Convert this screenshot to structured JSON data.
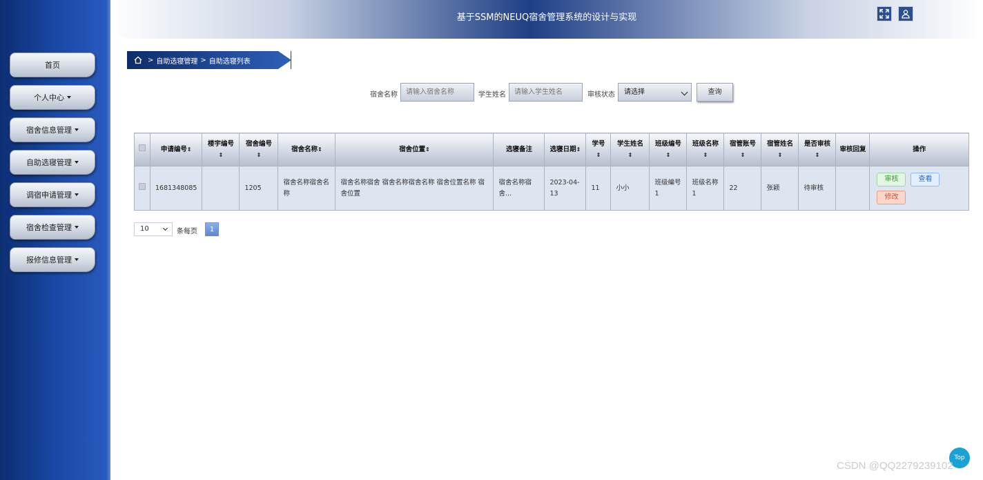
{
  "header": {
    "title": "基于SSM的NEUQ宿舍管理系统的设计与实现",
    "icons": [
      "fullscreen-icon",
      "user-icon"
    ]
  },
  "sidebar": {
    "items": [
      {
        "label": "首页",
        "has_dropdown": false
      },
      {
        "label": "个人中心",
        "has_dropdown": true
      },
      {
        "label": "宿舍信息管理",
        "has_dropdown": true
      },
      {
        "label": "自助选寝管理",
        "has_dropdown": true
      },
      {
        "label": "调宿申请管理",
        "has_dropdown": true
      },
      {
        "label": "宿舍检查管理",
        "has_dropdown": true
      },
      {
        "label": "报修信息管理",
        "has_dropdown": true
      }
    ]
  },
  "breadcrumb": {
    "sep": ">",
    "items": [
      "自助选寝管理",
      "自助选寝列表"
    ]
  },
  "search": {
    "dorm_name_label": "宿舍名称",
    "dorm_name_placeholder": "请输入宿舍名称",
    "student_name_label": "学生姓名",
    "student_name_placeholder": "请输入学生姓名",
    "audit_label": "审核状态",
    "audit_selected": "请选择",
    "query_label": "查询"
  },
  "table": {
    "columns": [
      "申请编号",
      "楼宇编号",
      "宿舍编号",
      "宿舍名称",
      "宿舍位置",
      "选寝备注",
      "选寝日期",
      "学号",
      "学生姓名",
      "班级编号",
      "班级名称",
      "宿管账号",
      "宿管姓名",
      "是否审核",
      "审核回复",
      "操作"
    ],
    "rows": [
      {
        "cells": [
          "1681348085",
          "",
          "1205",
          "宿舍名称宿舍名称",
          "宿舍名称宿舍 宿舍名称宿舍名称 宿舍位置名称 宿舍位置",
          "宿舍名称宿舍...",
          "2023-04-13",
          "11",
          "小小",
          "班级编号1",
          "班级名称1",
          "22",
          "张颖",
          "待审核",
          ""
        ],
        "actions": {
          "audit": "审核",
          "view": "查看",
          "edit": "修改"
        }
      }
    ]
  },
  "pagination": {
    "page_size": "10",
    "per_page_label": "条每页",
    "current_page": "1"
  },
  "back_to_top": "Top",
  "watermark": "CSDN @QQ2279239102"
}
